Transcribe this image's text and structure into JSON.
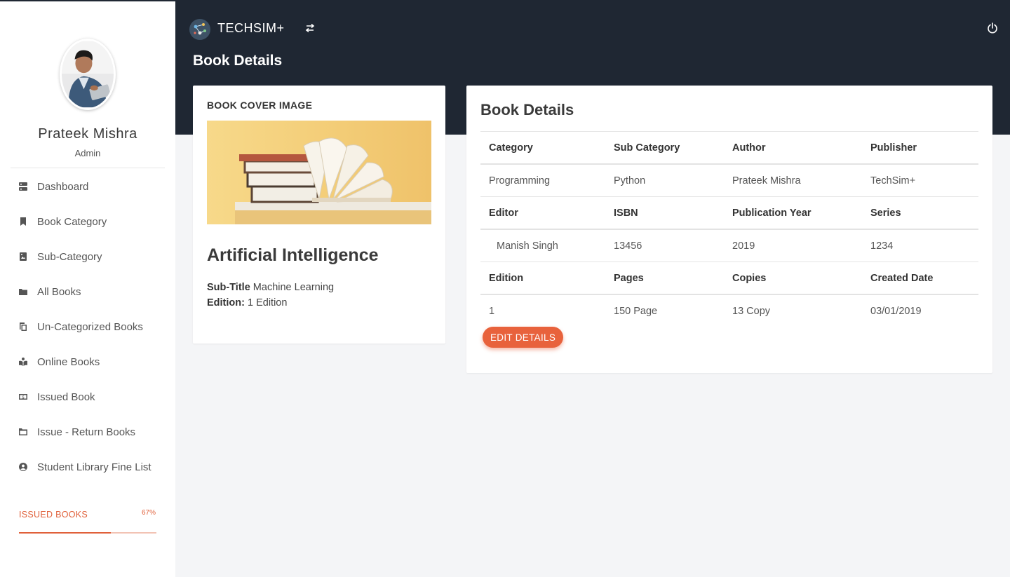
{
  "sidebar": {
    "user_name": "Prateek Mishra",
    "user_role": "Admin",
    "items": [
      {
        "label": "Dashboard",
        "icon": "dashboard-icon"
      },
      {
        "label": "Book Category",
        "icon": "bookmark-icon"
      },
      {
        "label": "Sub-Category",
        "icon": "book-image-icon"
      },
      {
        "label": "All Books",
        "icon": "folder-icon"
      },
      {
        "label": "Un-Categorized Books",
        "icon": "copy-icon"
      },
      {
        "label": "Online Books",
        "icon": "open-book-icon"
      },
      {
        "label": "Issued Book",
        "icon": "money-icon"
      },
      {
        "label": "Issue - Return Books",
        "icon": "folder-open-icon"
      },
      {
        "label": "Student Library Fine List",
        "icon": "user-circle-icon"
      }
    ],
    "progress": {
      "label": "ISSUED BOOKS",
      "value_text": "67%",
      "value": 0.67
    }
  },
  "header": {
    "brand": "TECHSIM+",
    "page_title": "Book Details"
  },
  "cover_card": {
    "heading": "BOOK COVER IMAGE",
    "title": "Artificial Intelligence",
    "subtitle_label": "Sub-Title",
    "subtitle_value": "Machine Learning",
    "edition_label": "Edition:",
    "edition_value": "1 Edition"
  },
  "details_card": {
    "heading": "Book Details",
    "rows": [
      {
        "type": "head",
        "cells": [
          "Category",
          "Sub Category",
          "Author",
          "Publisher"
        ]
      },
      {
        "type": "value",
        "cells": [
          "Programming",
          "Python",
          "Prateek Mishra",
          "TechSim+"
        ]
      },
      {
        "type": "head",
        "cells": [
          "Editor",
          "ISBN",
          "Publication Year",
          "Series"
        ]
      },
      {
        "type": "value",
        "cells": [
          "Manish Singh",
          "13456",
          "2019",
          "1234"
        ]
      },
      {
        "type": "head",
        "cells": [
          "Edition",
          "Pages",
          "Copies",
          "Created Date"
        ]
      },
      {
        "type": "value",
        "cells": [
          "1",
          "150 Page",
          "13 Copy",
          "03/01/2019"
        ]
      }
    ],
    "edit_button": "EDIT DETAILS"
  },
  "colors": {
    "header_bg": "#1f2733",
    "accent": "#e8623c",
    "page_bg": "#f4f5f7"
  }
}
